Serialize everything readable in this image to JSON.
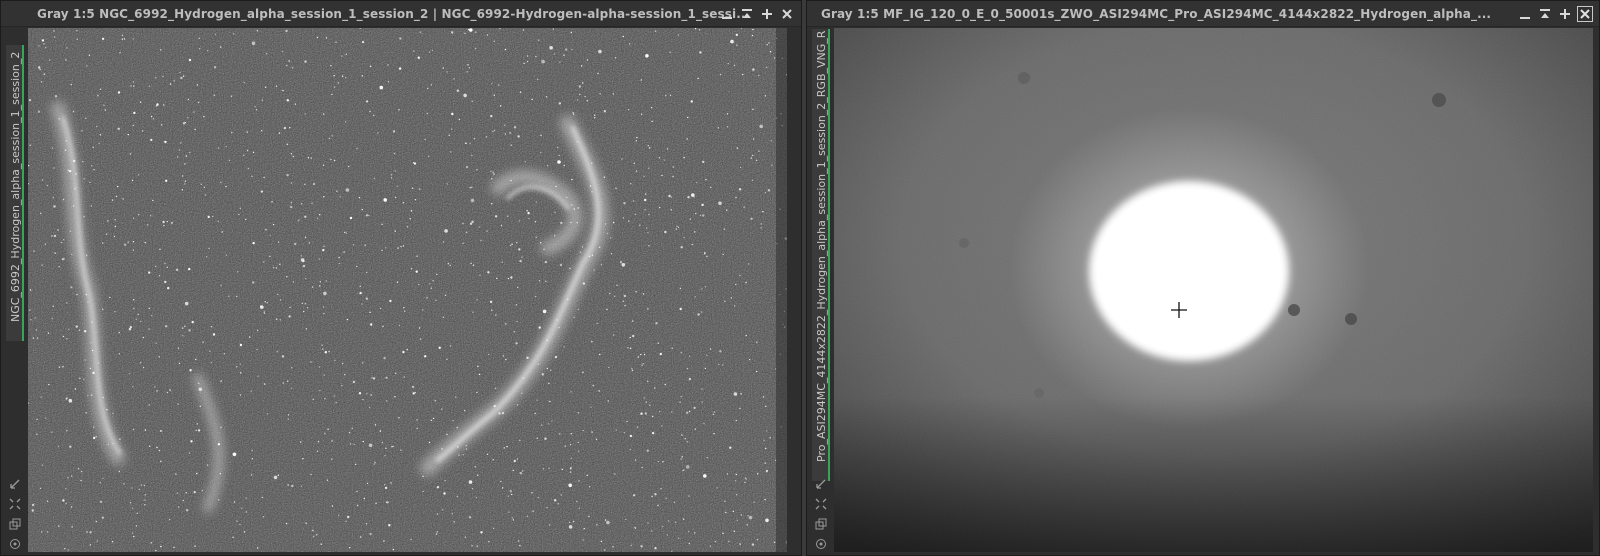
{
  "windows": [
    {
      "id": "left",
      "title": "Gray 1:5 NGC_6992_Hydrogen_alpha_session_1_session_2 | NGC_6992-Hydrogen-alpha-session_1_sessi...",
      "tab_label": "NGC_6992_Hydrogen_alpha_session_1_session_2",
      "buttons": [
        "minimize-icon",
        "shade-icon",
        "maximize-icon",
        "close-icon"
      ]
    },
    {
      "id": "right",
      "title": "Gray 1:5 MF_IG_120_0_E_0_50001s_ZWO_ASI294MC_Pro_ASI294MC_4144x2822_Hydrogen_alpha_...",
      "tab_label": "Pro_ASI294MC_4144x2822_Hydrogen_alpha_session_1_session_2_RGB_VNG_R",
      "buttons": [
        "minimize-icon",
        "shade-icon",
        "maximize-icon",
        "close-icon"
      ]
    }
  ],
  "colors": {
    "tab_accent": "#3aa35a",
    "title_bar": "#323232",
    "title_text": "#bdbdbd"
  }
}
